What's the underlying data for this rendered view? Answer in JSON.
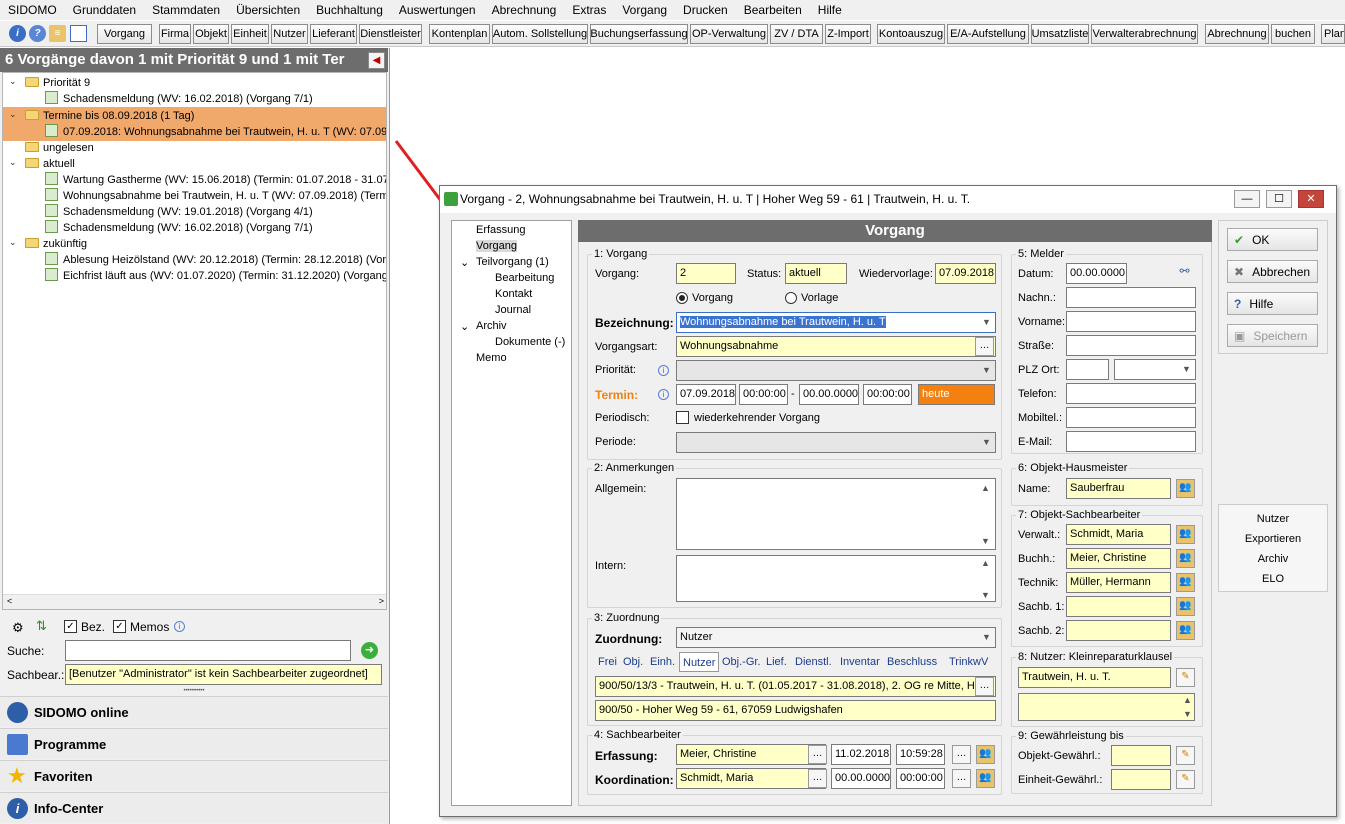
{
  "menu": [
    "SIDOMO",
    "Grunddaten",
    "Stammdaten",
    "Übersichten",
    "Buchhaltung",
    "Auswertungen",
    "Abrechnung",
    "Extras",
    "Vorgang",
    "Drucken",
    "Bearbeiten",
    "Hilfe"
  ],
  "toolbar": [
    "Vorgang",
    "Firma",
    "Objekt",
    "Einheit",
    "Nutzer",
    "Lieferant",
    "Dienstleister",
    "Kontenplan",
    "Autom. Sollstellung",
    "Buchungserfassung",
    "OP-Verwaltung",
    "ZV / DTA",
    "Z-Import",
    "Kontoauszug",
    "E/A-Aufstellung",
    "Umsatzliste",
    "Verwalterabrechnung",
    "Abrechnung",
    "buchen",
    "Plan"
  ],
  "tree": {
    "header": "6 Vorgänge davon 1 mit Priorität 9 und 1 mit Ter",
    "rows": [
      "Priorität 9",
      "Schadensmeldung (WV: 16.02.2018) (Vorgang 7/1)",
      "Termine bis 08.09.2018 (1 Tag)",
      "07.09.2018: Wohnungsabnahme bei Trautwein, H. u. T (WV: 07.09.2",
      "ungelesen",
      "aktuell",
      "Wartung Gastherme (WV: 15.06.2018) (Termin: 01.07.2018 - 31.07.2",
      "Wohnungsabnahme bei Trautwein, H. u. T (WV: 07.09.2018) (Termi",
      "Schadensmeldung (WV: 19.01.2018) (Vorgang 4/1)",
      "Schadensmeldung (WV: 16.02.2018) (Vorgang 7/1)",
      "zukünftig",
      "Ablesung Heizölstand (WV: 20.12.2018) (Termin: 28.12.2018) (Vorga",
      "Eichfrist läuft aus (WV: 01.07.2020) (Termin: 31.12.2020) (Vorgang 8"
    ]
  },
  "filter": {
    "bez": "Bez.",
    "memos": "Memos",
    "suche_label": "Suche:",
    "suche_value": "",
    "sachbear_label": "Sachbear.:",
    "sachbear_value": "[Benutzer \"Administrator\" ist kein Sachbearbeiter zugeordnet]",
    "grip": "••••••••••"
  },
  "nav": [
    "SIDOMO online",
    "Programme",
    "Favoriten",
    "Info-Center"
  ],
  "dialog": {
    "title": "Vorgang - 2, Wohnungsabnahme bei Trautwein, H. u. T | Hoher Weg 59 - 61 | Trautwein, H. u. T.",
    "tree": [
      "Erfassung",
      "Vorgang",
      "Teilvorgang (1)",
      "Bearbeitung",
      "Kontakt",
      "Journal",
      "Archiv",
      "Dokumente (-)",
      "Memo"
    ],
    "header": "Vorgang",
    "s1": {
      "title": "1: Vorgang",
      "vorgang_label": "Vorgang:",
      "vorgang": "2",
      "status_label": "Status:",
      "status": "aktuell",
      "wv_label": "Wiedervorlage:",
      "wv": "07.09.2018",
      "radio1": "Vorgang",
      "radio2": "Vorlage",
      "bez_label": "Bezeichnung:",
      "bez": "Wohnungsabnahme bei Trautwein, H. u. T",
      "art_label": "Vorgangsart:",
      "art": "Wohnungsabnahme",
      "prio_label": "Priorität:",
      "termin_label": "Termin:",
      "t_date1": "07.09.2018",
      "t_time1": "00:00:00",
      "t_sep": "-",
      "t_date2": "00.00.0000",
      "t_time2": "00:00:00",
      "heute": "heute",
      "period_label": "Periodisch:",
      "period_text": "wiederkehrender Vorgang",
      "periode_label": "Periode:"
    },
    "s2": {
      "title": "2: Anmerkungen",
      "allg": "Allgemein:",
      "intern": "Intern:"
    },
    "s3": {
      "title": "3: Zuordnung",
      "zuo_label": "Zuordnung:",
      "zuo": "Nutzer",
      "tabs": [
        "Frei",
        "Obj.",
        "Einh.",
        "Nutzer",
        "Obj.-Gr.",
        "Lief.",
        "Dienstl.",
        "Inventar",
        "Beschluss",
        "TrinkwV"
      ],
      "line1": "900/50/13/3 - Trautwein, H. u. T.  (01.05.2017 - 31.08.2018), 2. OG re Mitte, H",
      "line2": "900/50 - Hoher Weg 59 - 61, 67059 Ludwigshafen"
    },
    "s4": {
      "title": "4: Sachbearbeiter",
      "erf_label": "Erfassung:",
      "erf": "Meier, Christine",
      "erf_date": "11.02.2018",
      "erf_time": "10:59:28",
      "koo_label": "Koordination:",
      "koo": "Schmidt, Maria",
      "koo_date": "00.00.0000",
      "koo_time": "00:00:00"
    },
    "s5": {
      "title": "5: Melder",
      "labels": [
        "Datum:",
        "Nachn.:",
        "Vorname:",
        "Straße:",
        "PLZ Ort:",
        "Telefon:",
        "Mobiltel.:",
        "E-Mail:"
      ],
      "datum": "00.00.0000"
    },
    "s6": {
      "title": "6: Objekt-Hausmeister",
      "name_label": "Name:",
      "name": "Sauberfrau"
    },
    "s7": {
      "title": "7: Objekt-Sachbearbeiter",
      "labels": [
        "Verwalt.:",
        "Buchh.:",
        "Technik:",
        "Sachb. 1:",
        "Sachb. 2:"
      ],
      "values": [
        "Schmidt, Maria",
        "Meier, Christine",
        "Müller, Hermann",
        "",
        ""
      ]
    },
    "s8": {
      "title": "8: Nutzer: Kleinreparaturklausel",
      "value": "Trautwein, H. u. T."
    },
    "s9": {
      "title": "9: Gewährleistung bis",
      "obj_label": "Objekt-Gewährl.:",
      "ein_label": "Einheit-Gewährl.:"
    },
    "buttons": {
      "ok": "OK",
      "abbrechen": "Abbrechen",
      "hilfe": "Hilfe",
      "speichern": "Speichern"
    },
    "side": [
      "Nutzer",
      "Exportieren",
      "Archiv",
      "ELO"
    ]
  }
}
